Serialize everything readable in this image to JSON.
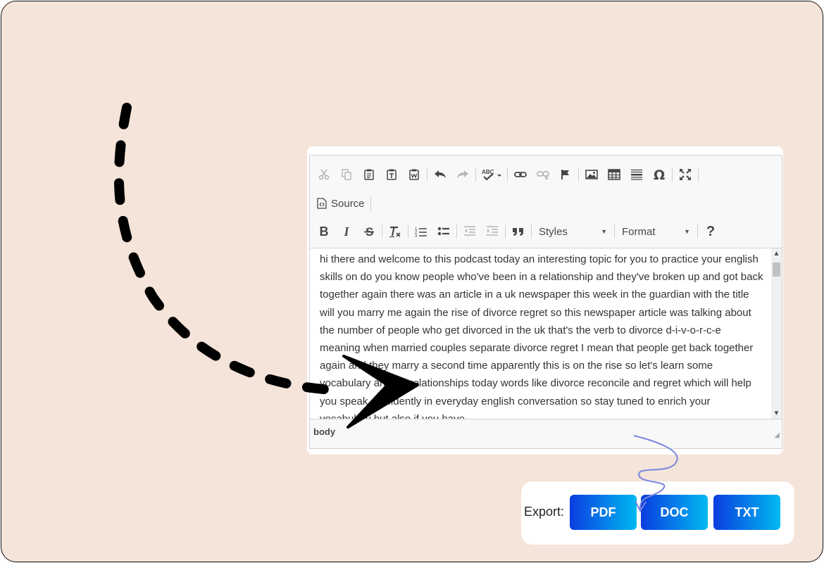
{
  "toolbar": {
    "source_label": "Source",
    "styles_label": "Styles",
    "format_label": "Format"
  },
  "editor": {
    "content": "hi there and welcome to this podcast today an interesting topic for you to practice your english skills on do you know people who've been in a relationship and they've broken up and got back together again there was an article in a uk newspaper this week in the guardian with the title will you marry me again the rise of divorce regret so this newspaper article was talking about the number of people who get divorced in the uk that's the verb to divorce d-i-v-o-r-c-e meaning when married couples separate divorce regret I mean that people get back together again and they marry a second time apparently this is on the rise so let's learn some vocabulary around relationships today words like divorce reconcile and regret which will help you speak confidently in everyday english conversation so stay tuned to enrich your vocabulary but also if you have",
    "status_path": "body"
  },
  "export": {
    "label": "Export:",
    "buttons": [
      "PDF",
      "DOC",
      "TXT"
    ]
  },
  "colors": {
    "background": "#f4e4d9",
    "button_gradient_start": "#0b3de0",
    "button_gradient_end": "#00b9f0",
    "squiggle": "#7b86e0"
  }
}
